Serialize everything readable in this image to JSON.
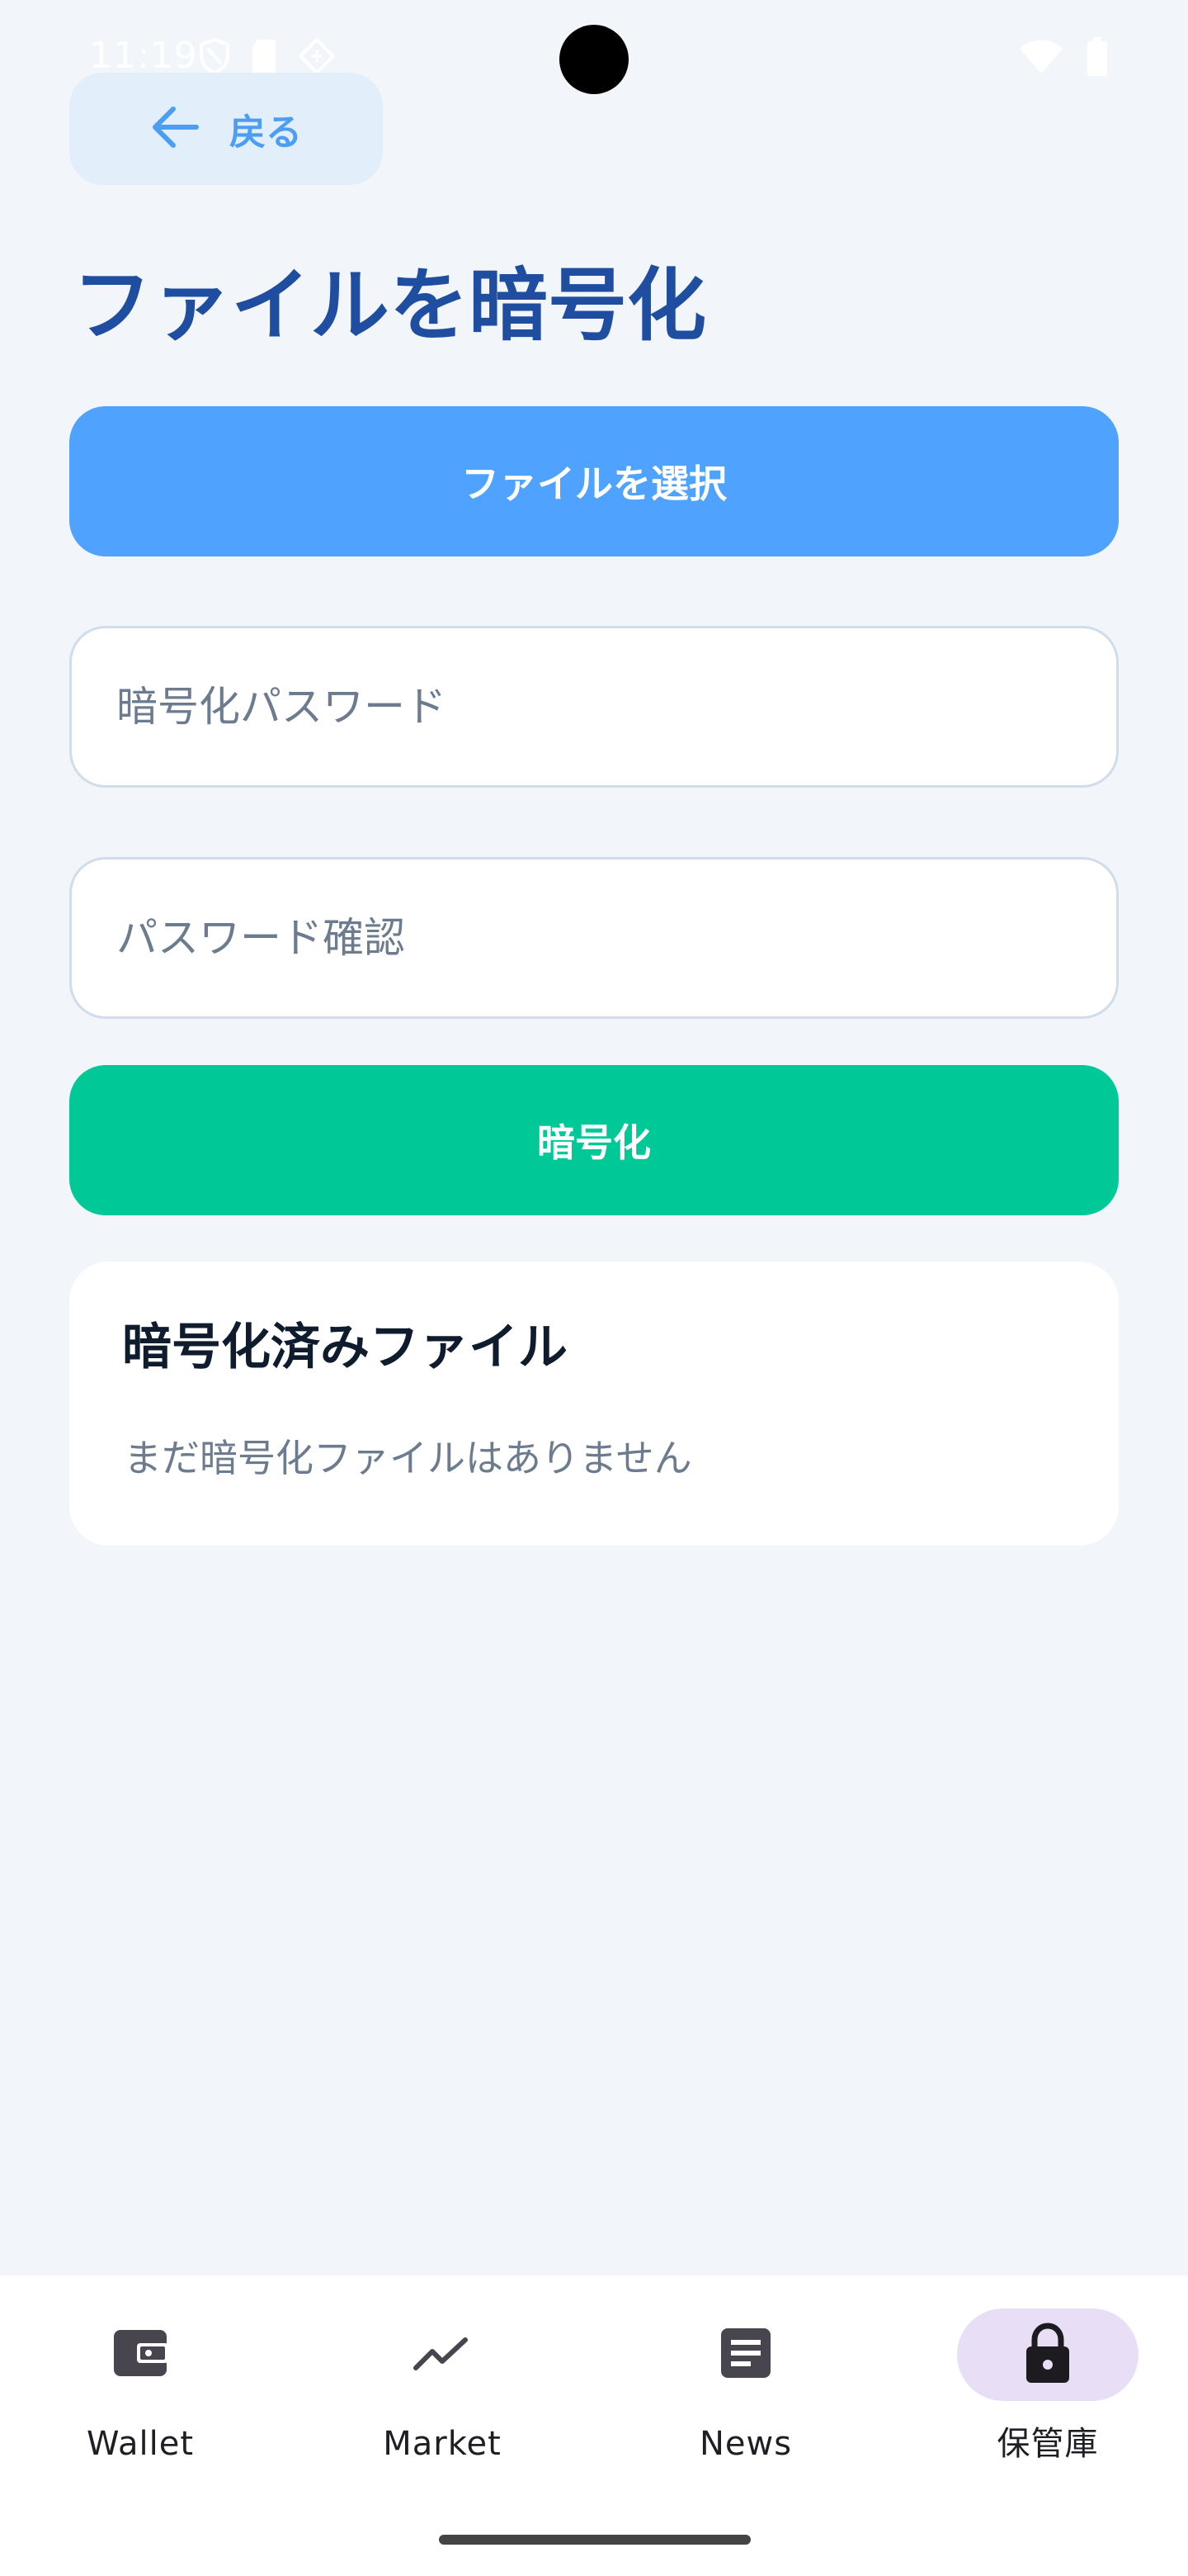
{
  "status_bar": {
    "time": "11:19"
  },
  "header": {
    "back_label": "戻る",
    "title": "ファイルを暗号化"
  },
  "form": {
    "select_file_label": "ファイルを選択",
    "password_placeholder": "暗号化パスワード",
    "confirm_placeholder": "パスワード確認",
    "encrypt_label": "暗号化"
  },
  "encrypted_files": {
    "title": "暗号化済みファイル",
    "empty_message": "まだ暗号化ファイルはありません"
  },
  "bottom_nav": {
    "items": [
      {
        "label": "Wallet",
        "icon": "wallet-icon",
        "active": false
      },
      {
        "label": "Market",
        "icon": "trending-up-icon",
        "active": false
      },
      {
        "label": "News",
        "icon": "article-icon",
        "active": false
      },
      {
        "label": "保管庫",
        "icon": "lock-icon",
        "active": true
      }
    ]
  },
  "colors": {
    "background": "#F2F6FB",
    "title": "#1F4EA1",
    "select_button": "#4FA3FF",
    "encrypt_button": "#00C896",
    "back_button_bg": "#E3EEFB",
    "back_button_text": "#4B9EF3",
    "active_nav_pill": "#E8DEF5"
  }
}
